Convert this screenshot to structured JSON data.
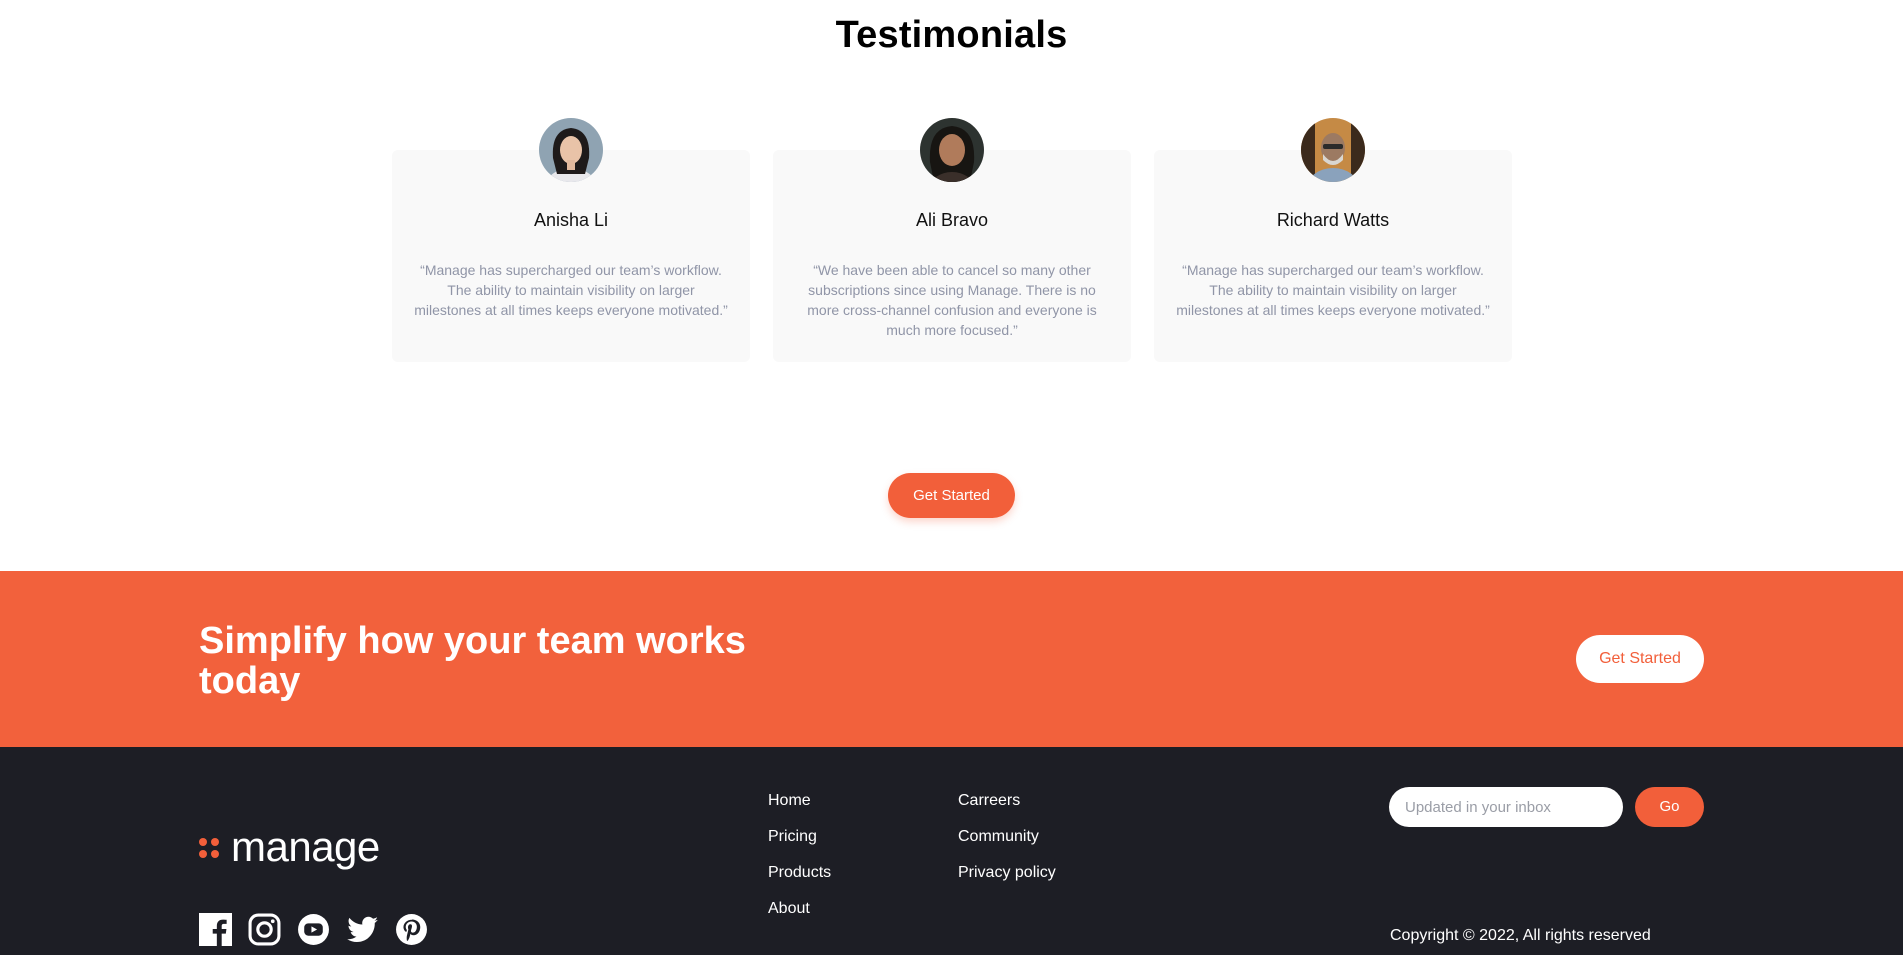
{
  "testimonials": {
    "title": "Testimonials",
    "cards": [
      {
        "name": "Anisha Li",
        "quote": "“Manage has supercharged our team’s workflow. The ability to maintain visibility on larger milestones at all times keeps everyone motivated.”"
      },
      {
        "name": "Ali Bravo",
        "quote": "“We have been able to cancel so many other subscriptions since using Manage. There is no more cross-channel confusion and everyone is much more focused.”"
      },
      {
        "name": "Richard Watts",
        "quote": "“Manage has supercharged our team’s workflow. The ability to maintain visibility on larger milestones at all times keeps everyone motivated.”"
      }
    ],
    "cta_label": "Get Started"
  },
  "cta_band": {
    "heading": "Simplify how your team works today",
    "button_label": "Get Started"
  },
  "footer": {
    "logo_text": "manage",
    "links_col1": [
      "Home",
      "Pricing",
      "Products",
      "About"
    ],
    "links_col2": [
      "Carreers",
      "Community",
      "Privacy policy"
    ],
    "social_icons": [
      "facebook-icon",
      "instagram-icon",
      "youtube-icon",
      "twitter-icon",
      "pinterest-icon"
    ],
    "newsletter": {
      "placeholder": "Updated in your inbox",
      "button_label": "Go"
    },
    "copyright": "Copyright © 2022, All rights reserved"
  },
  "colors": {
    "accent": "#f25f3a",
    "cta_band": "#f2613c",
    "footer_bg": "#1d1e25",
    "card_bg": "#f9f9f9"
  }
}
